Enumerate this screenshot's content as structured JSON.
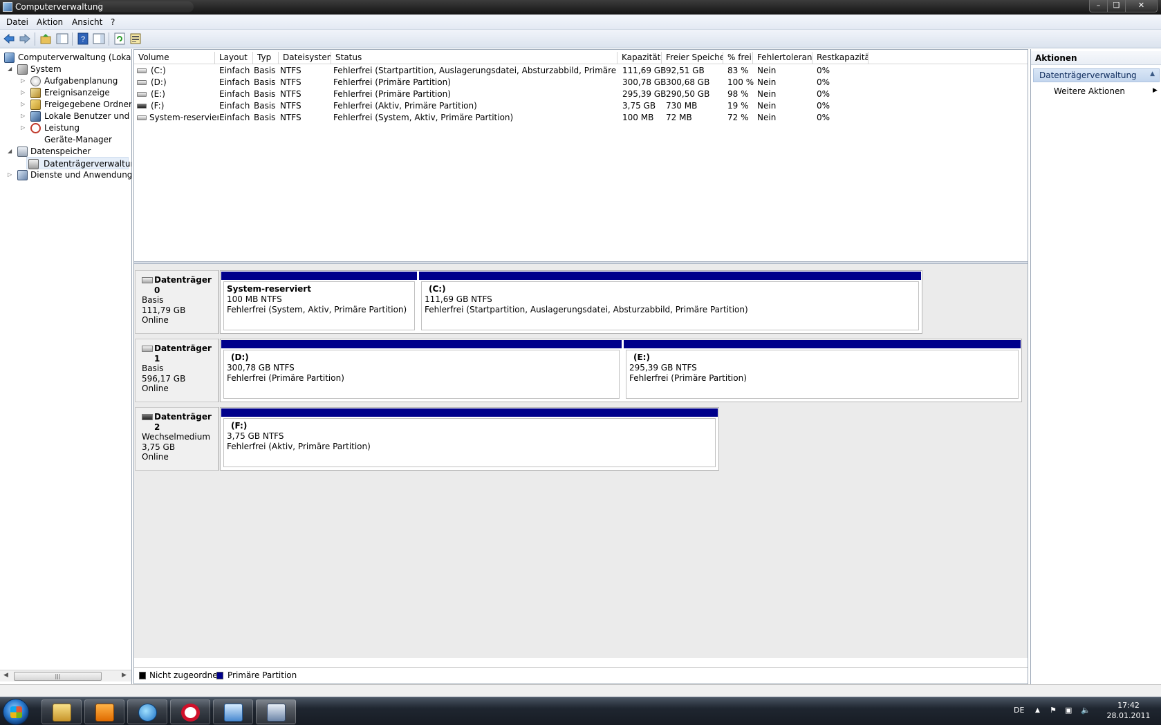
{
  "window": {
    "title": "Computerverwaltung"
  },
  "menu": [
    "Datei",
    "Aktion",
    "Ansicht",
    "?"
  ],
  "tree": [
    {
      "label": "Computerverwaltung (Lokal)",
      "icon": "computer-management-icon"
    },
    {
      "label": "System",
      "icon": "system-tools-icon"
    },
    {
      "label": "Aufgabenplanung",
      "icon": "task-scheduler-icon"
    },
    {
      "label": "Ereignisanzeige",
      "icon": "event-viewer-icon"
    },
    {
      "label": "Freigegebene Ordner",
      "icon": "shared-folders-icon"
    },
    {
      "label": "Lokale Benutzer und Gr",
      "icon": "local-users-icon"
    },
    {
      "label": "Leistung",
      "icon": "performance-icon"
    },
    {
      "label": "Geräte-Manager",
      "icon": "device-manager-icon"
    },
    {
      "label": "Datenspeicher",
      "icon": "storage-icon"
    },
    {
      "label": "Datenträgerverwaltung",
      "icon": "disk-management-icon"
    },
    {
      "label": "Dienste und Anwendungen",
      "icon": "services-icon"
    }
  ],
  "volume_list": {
    "columns": [
      "Volume",
      "Layout",
      "Typ",
      "Dateisystem",
      "Status",
      "Kapazität",
      "Freier Speicher",
      "% frei",
      "Fehlertoleranz",
      "Restkapazität"
    ],
    "rows": [
      [
        "(C:)",
        "Einfach",
        "Basis",
        "NTFS",
        "Fehlerfrei (Startpartition, Auslagerungsdatei, Absturzabbild, Primäre Partition)",
        "111,69 GB",
        "92,51 GB",
        "83 %",
        "Nein",
        "0%"
      ],
      [
        "(D:)",
        "Einfach",
        "Basis",
        "NTFS",
        "Fehlerfrei (Primäre Partition)",
        "300,78 GB",
        "300,68 GB",
        "100 %",
        "Nein",
        "0%"
      ],
      [
        "(E:)",
        "Einfach",
        "Basis",
        "NTFS",
        "Fehlerfrei (Primäre Partition)",
        "295,39 GB",
        "290,50 GB",
        "98 %",
        "Nein",
        "0%"
      ],
      [
        "(F:)",
        "Einfach",
        "Basis",
        "NTFS",
        "Fehlerfrei (Aktiv, Primäre Partition)",
        "3,75 GB",
        "730 MB",
        "19 %",
        "Nein",
        "0%"
      ],
      [
        "System-reserviert",
        "Einfach",
        "Basis",
        "NTFS",
        "Fehlerfrei (System, Aktiv, Primäre Partition)",
        "100 MB",
        "72 MB",
        "72 %",
        "Nein",
        "0%"
      ]
    ]
  },
  "disks": [
    {
      "name": "Datenträger 0",
      "type": "Basis",
      "size": "111,79 GB",
      "state": "Online",
      "partitions": [
        {
          "name": "System-reserviert",
          "size": "100 MB NTFS",
          "status": "Fehlerfrei (System, Aktiv, Primäre Partition)"
        },
        {
          "name": "(C:)",
          "size": "111,69 GB NTFS",
          "status": "Fehlerfrei (Startpartition, Auslagerungsdatei, Absturzabbild, Primäre Partition)"
        }
      ]
    },
    {
      "name": "Datenträger 1",
      "type": "Basis",
      "size": "596,17 GB",
      "state": "Online",
      "partitions": [
        {
          "name": "(D:)",
          "size": "300,78 GB NTFS",
          "status": "Fehlerfrei (Primäre Partition)"
        },
        {
          "name": "(E:)",
          "size": "295,39 GB NTFS",
          "status": "Fehlerfrei (Primäre Partition)"
        }
      ]
    },
    {
      "name": "Datenträger 2",
      "type": "Wechselmedium",
      "size": "3,75 GB",
      "state": "Online",
      "partitions": [
        {
          "name": "(F:)",
          "size": "3,75 GB NTFS",
          "status": "Fehlerfrei (Aktiv, Primäre Partition)"
        }
      ]
    }
  ],
  "legend": [
    {
      "label": "Nicht zugeordnet",
      "color": "#000000"
    },
    {
      "label": "Primäre Partition",
      "color": "#00008b"
    }
  ],
  "actions": {
    "title": "Aktionen",
    "section": "Datenträgerverwaltung",
    "item": "Weitere Aktionen"
  },
  "taskbar": {
    "apps": [
      "explorer-icon",
      "media-player-icon",
      "download-icon",
      "opera-icon",
      "remote-desktop-icon",
      "computer-management-icon"
    ],
    "language": "DE",
    "time": "17:42",
    "date": "28.01.2011"
  },
  "colors": {
    "primary_partition": "#00008b",
    "selection": "#e5eef9"
  }
}
